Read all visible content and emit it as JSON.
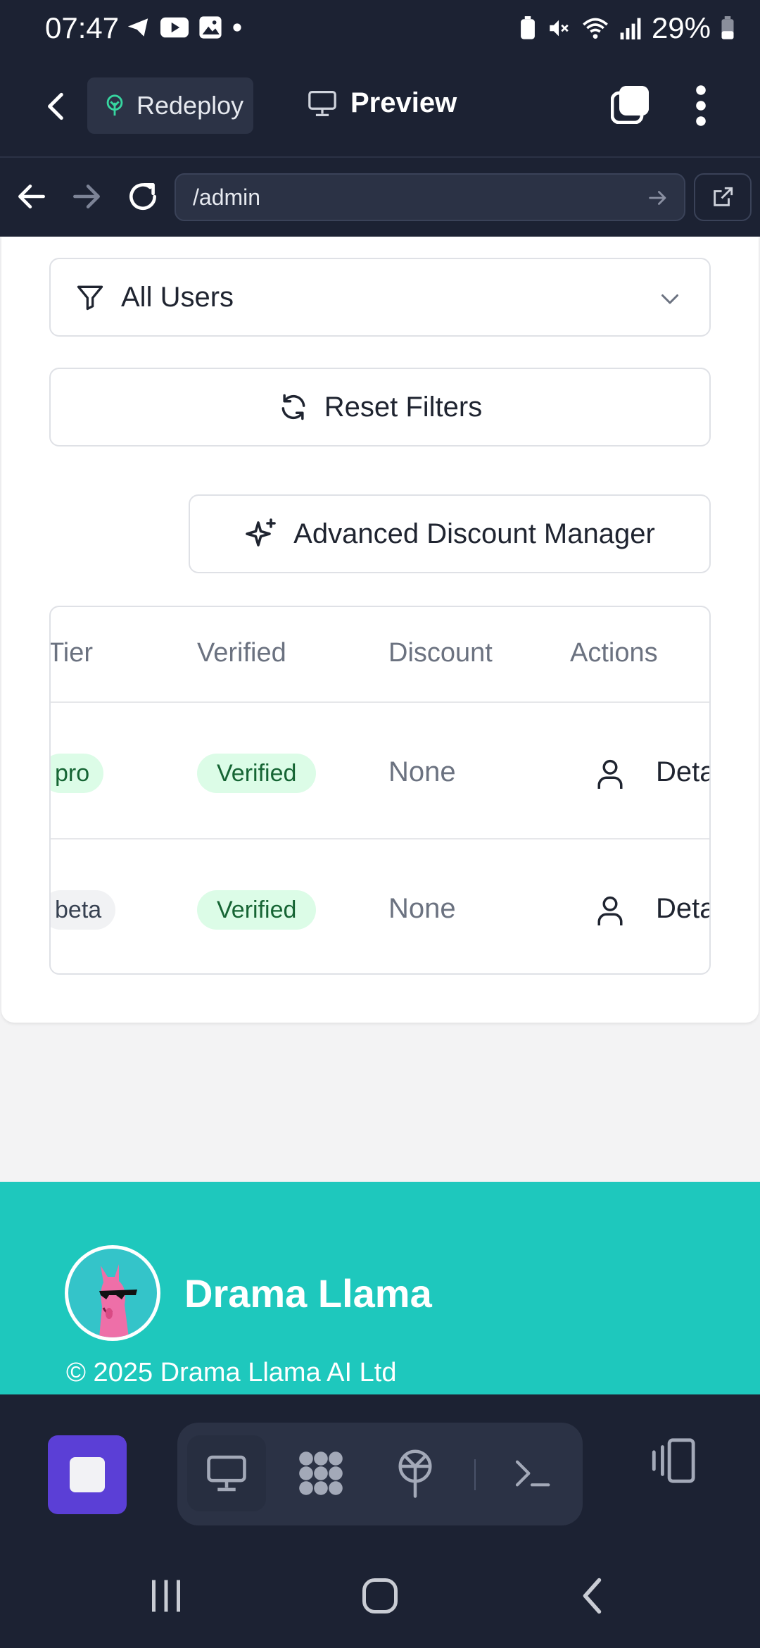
{
  "status_bar": {
    "time": "07:47",
    "battery": "29%"
  },
  "top_bar": {
    "redeploy_label": "Redeploy",
    "preview_label": "Preview"
  },
  "url_bar": {
    "url": "/admin"
  },
  "filters": {
    "user_filter_value": "All Users",
    "reset_label": "Reset Filters",
    "advanced_discount_label": "Advanced Discount Manager"
  },
  "table": {
    "columns": [
      "Tier",
      "Verified",
      "Discount",
      "Actions"
    ],
    "rows": [
      {
        "tier": "pro",
        "verified": "Verified",
        "discount": "None",
        "action": "Deta"
      },
      {
        "tier": "beta",
        "verified": "Verified",
        "discount": "None",
        "action": "Deta"
      }
    ]
  },
  "footer": {
    "brand": "Drama Llama",
    "copyright": "© 2025 Drama Llama AI Ltd"
  },
  "colors": {
    "accent_teal": "#1ec8bd",
    "dark_chrome": "#1c2233",
    "stop_button": "#5b3fd6",
    "verified_bg": "#dcfce7",
    "verified_text": "#166534"
  },
  "icons": [
    "send-icon",
    "youtube-icon",
    "gallery-icon",
    "wifi-icon",
    "mute-icon",
    "signal-icon",
    "battery-icon",
    "back-icon",
    "sprout-icon",
    "monitor-icon",
    "tabs-icon",
    "kebab-icon",
    "filter-icon",
    "chevron-down-icon",
    "refresh-icon",
    "sparkles-icon",
    "user-icon",
    "grid-icon",
    "deploy-icon",
    "terminal-icon",
    "devices-icon"
  ]
}
